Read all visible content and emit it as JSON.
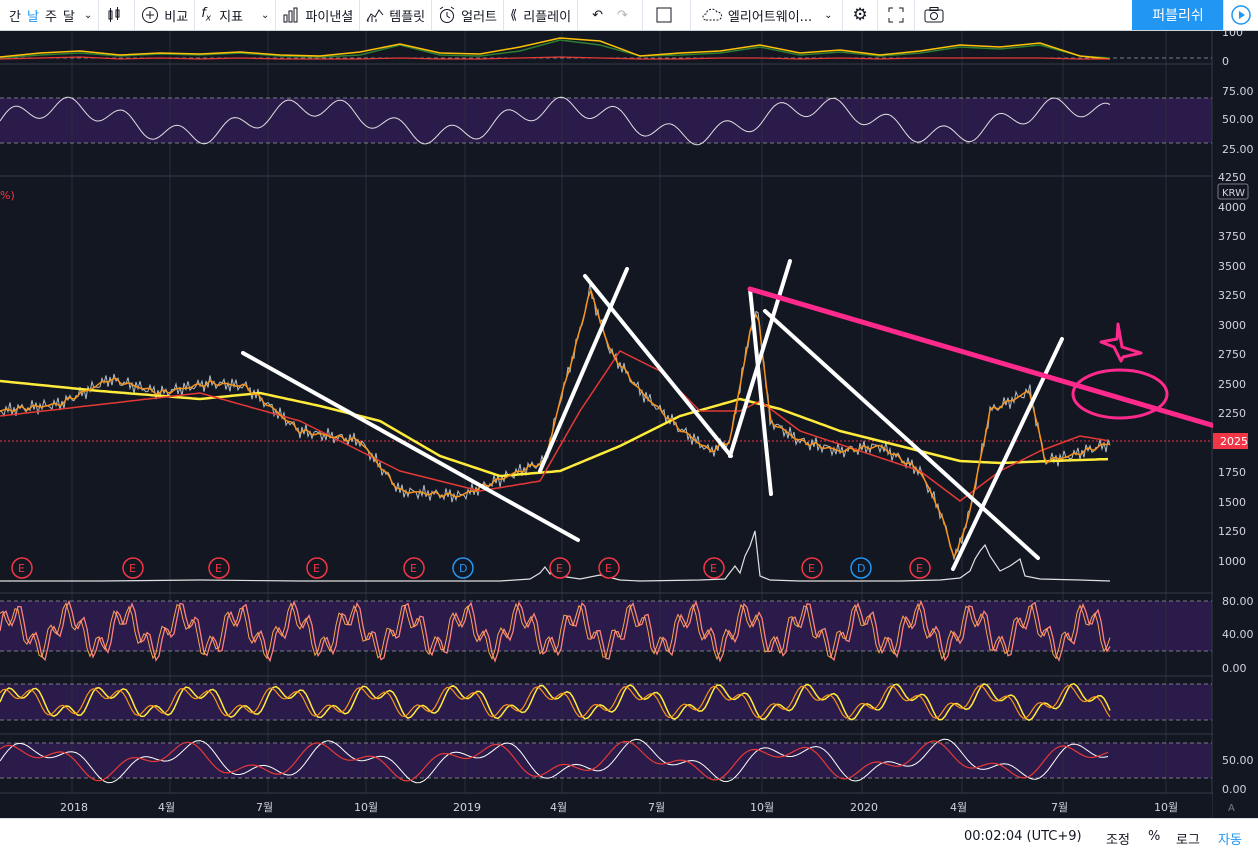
{
  "toolbar": {
    "intervals": [
      "간",
      "날",
      "주",
      "달"
    ],
    "active_interval": "날",
    "compare_label": "비교",
    "indicators_label": "지표",
    "pinescript_label": "파이낸셜",
    "templates_label": "템플릿",
    "alert_label": "얼러트",
    "replay_label": "리플레이",
    "layout_name": "엘리어트웨이...",
    "publish_label": "퍼블리쉬",
    "icons": [
      "candle-chart-icon",
      "plus-circle-icon",
      "fx-icon",
      "bar-chart-icon",
      "template-icon",
      "alarm-clock-icon",
      "rewind-icon",
      "undo-icon",
      "redo-icon",
      "square-icon",
      "cloud-icon",
      "gear-icon",
      "fullscreen-icon",
      "camera-icon",
      "play-icon"
    ]
  },
  "chart": {
    "main_left_label": "%)",
    "currency": "KRW",
    "last_price": "2025",
    "price_ticks": [
      "4250",
      "4000",
      "3750",
      "3500",
      "3250",
      "3000",
      "2750",
      "2500",
      "2250",
      "2025",
      "1750",
      "1500",
      "1250",
      "1000"
    ],
    "panes": {
      "top_osc_ticks": [
        "100",
        "0"
      ],
      "rsi_ticks": [
        "75.00",
        "50.00",
        "25.00"
      ],
      "stoch1_ticks": [
        "80.00",
        "40.00",
        "0.00"
      ],
      "stoch3_ticks": [
        "50.00",
        "0.00"
      ]
    },
    "x_labels": [
      "2018",
      "4월",
      "7월",
      "10월",
      "2019",
      "4월",
      "7월",
      "10월",
      "2020",
      "4월",
      "7월",
      "10월"
    ],
    "events": [
      "E",
      "E",
      "E",
      "E",
      "E",
      "D",
      "E",
      "E",
      "E",
      "E",
      "D",
      "E"
    ],
    "colors": {
      "bg": "#131722",
      "ma_fast": "#f7931a",
      "ma_mid": "#e53935",
      "ma_slow": "#ffeb3b",
      "trend_pink": "#ff2a8c",
      "pane_band": "#2a1b4a",
      "price_label": "#f23645"
    }
  },
  "status": {
    "time": "00:02:04 (UTC+9)",
    "adjust": "조정",
    "percent": "%",
    "log": "로그",
    "auto": "자동",
    "axis_mode_label": "A"
  }
}
